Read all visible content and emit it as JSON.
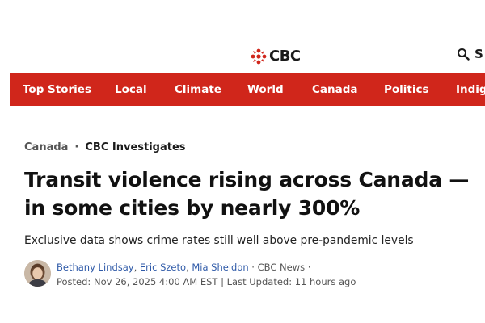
{
  "header": {
    "logo_text": "CBC",
    "search_label": "S",
    "logo_color": "#d0261b"
  },
  "nav": {
    "background": "#d0261b",
    "items": [
      {
        "label": "Top Stories"
      },
      {
        "label": "Local"
      },
      {
        "label": "Climate"
      },
      {
        "label": "World"
      },
      {
        "label": "Canada"
      },
      {
        "label": "Politics"
      },
      {
        "label": "Indig"
      }
    ]
  },
  "article": {
    "breadcrumb": [
      "Canada",
      "CBC Investigates"
    ],
    "breadcrumb_separator": "·",
    "headline": "Transit violence rising across Canada — in some cities by nearly 300%",
    "deck": "Exclusive data shows crime rates still well above pre-pandemic levels",
    "authors": [
      "Bethany Lindsay",
      "Eric Szeto",
      "Mia Sheldon"
    ],
    "author_separator": ", ",
    "source": "CBC News",
    "posted": "Posted: Nov 26, 2025 4:00 AM EST",
    "updated": "Last Updated: 11 hours ago",
    "author_link_color": "#2f5aa8"
  },
  "icons": [
    "cbc-gem-icon",
    "search-icon"
  ]
}
